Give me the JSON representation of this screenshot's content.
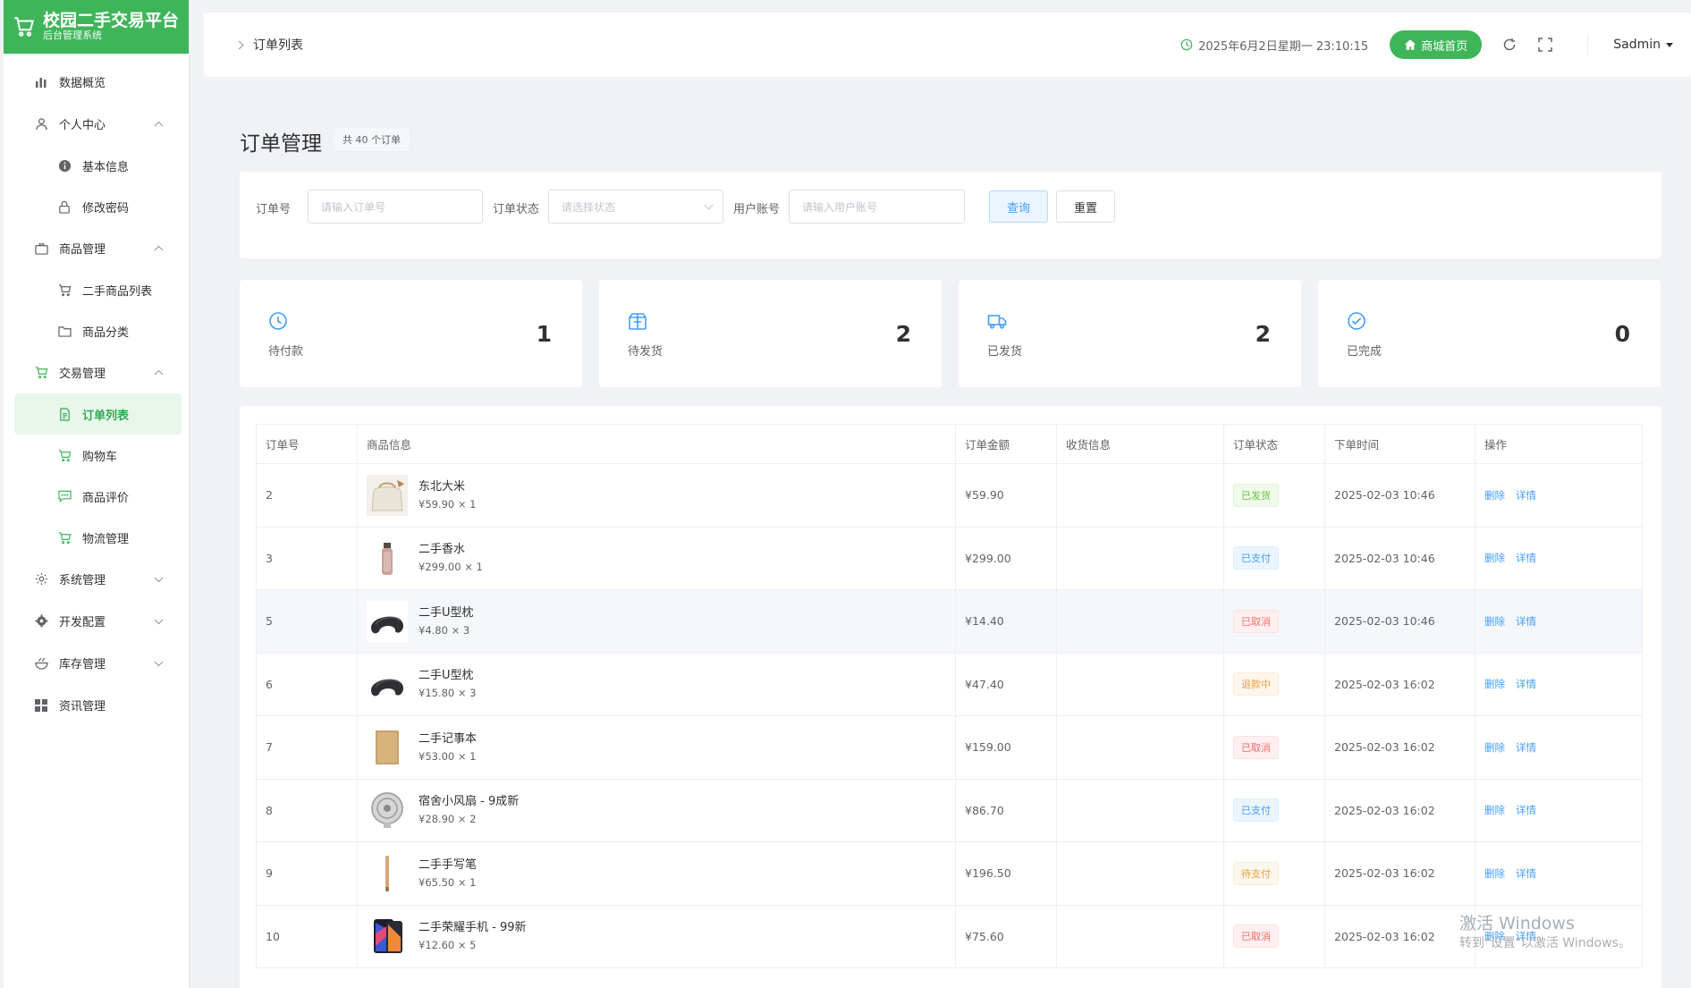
{
  "brand": {
    "title": "校园二手交易平台",
    "subtitle": "后台管理系统"
  },
  "sidebar": {
    "items": [
      {
        "label": "数据概览"
      },
      {
        "label": "个人中心"
      },
      {
        "label": "基本信息"
      },
      {
        "label": "修改密码"
      },
      {
        "label": "商品管理"
      },
      {
        "label": "二手商品列表"
      },
      {
        "label": "商品分类"
      },
      {
        "label": "交易管理"
      },
      {
        "label": "订单列表"
      },
      {
        "label": "购物车"
      },
      {
        "label": "商品评价"
      },
      {
        "label": "物流管理"
      },
      {
        "label": "系统管理"
      },
      {
        "label": "开发配置"
      },
      {
        "label": "库存管理"
      },
      {
        "label": "资讯管理"
      }
    ]
  },
  "header": {
    "breadcrumb": "订单列表",
    "datetime": "2025年6月2日星期一 23:10:15",
    "home_label": "商城首页",
    "user": "Sadmin"
  },
  "page": {
    "title": "订单管理",
    "count": "共 40 个订单"
  },
  "filter": {
    "order_no_label": "订单号",
    "order_no_placeholder": "请输入订单号",
    "status_label": "订单状态",
    "status_placeholder": "请选择状态",
    "account_label": "用户账号",
    "account_placeholder": "请输入用户账号",
    "query_label": "查询",
    "reset_label": "重置"
  },
  "stats": [
    {
      "label": "待付款",
      "value": "1"
    },
    {
      "label": "待发货",
      "value": "2"
    },
    {
      "label": "已发货",
      "value": "2"
    },
    {
      "label": "已完成",
      "value": "0"
    }
  ],
  "table": {
    "columns": [
      "订单号",
      "商品信息",
      "订单金额",
      "收货信息",
      "订单状态",
      "下单时间",
      "操作"
    ],
    "rows": [
      {
        "id": "2",
        "name": "东北大米",
        "price": "¥59.90 × 1",
        "amount": "¥59.90",
        "address": "",
        "status": "已发货",
        "time": "2025-02-03 10:46"
      },
      {
        "id": "3",
        "name": "二手香水",
        "price": "¥299.00 × 1",
        "amount": "¥299.00",
        "address": "",
        "status": "已支付",
        "time": "2025-02-03 10:46"
      },
      {
        "id": "5",
        "name": "二手U型枕",
        "price": "¥4.80 × 3",
        "amount": "¥14.40",
        "address": "",
        "status": "已取消",
        "time": "2025-02-03 10:46"
      },
      {
        "id": "6",
        "name": "二手U型枕",
        "price": "¥15.80 × 3",
        "amount": "¥47.40",
        "address": "",
        "status": "退款中",
        "time": "2025-02-03 16:02"
      },
      {
        "id": "7",
        "name": "二手记事本",
        "price": "¥53.00 × 1",
        "amount": "¥159.00",
        "address": "",
        "status": "已取消",
        "time": "2025-02-03 16:02"
      },
      {
        "id": "8",
        "name": "宿舍小风扇 - 9成新",
        "price": "¥28.90 × 2",
        "amount": "¥86.70",
        "address": "",
        "status": "已支付",
        "time": "2025-02-03 16:02"
      },
      {
        "id": "9",
        "name": "二手手写笔",
        "price": "¥65.50 × 1",
        "amount": "¥196.50",
        "address": "",
        "status": "待支付",
        "time": "2025-02-03 16:02"
      },
      {
        "id": "10",
        "name": "二手荣耀手机 - 99新",
        "price": "¥12.60 × 5",
        "amount": "¥75.60",
        "address": "",
        "status": "已取消",
        "time": "2025-02-03 16:02"
      }
    ],
    "op_delete": "删除",
    "op_detail": "详情"
  },
  "watermark": {
    "line1": "激活 Windows",
    "line2": "转到\"设置\"以激活 Windows。"
  },
  "colors": {
    "brand": "#3fb55a",
    "link": "#409eff"
  }
}
